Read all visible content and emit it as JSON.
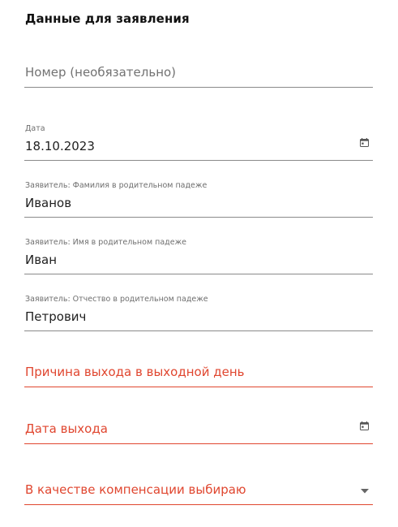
{
  "form": {
    "title": "Данные для заявления",
    "number": {
      "placeholder": "Номер (необязательно)"
    },
    "date": {
      "label": "Дата",
      "value": "18.10.2023"
    },
    "surname": {
      "label": "Заявитель: Фамилия в родительном падеже",
      "value": "Иванов"
    },
    "name": {
      "label": "Заявитель: Имя в родительном падеже",
      "value": "Иван"
    },
    "patronymic": {
      "label": "Заявитель: Отчество в родительном падеже",
      "value": "Петрович"
    },
    "reason": {
      "placeholder": "Причина выхода в выходной день"
    },
    "work_date": {
      "placeholder": "Дата выхода"
    },
    "compensation": {
      "placeholder": "В качестве компенсации выбираю"
    }
  },
  "colors": {
    "error": "#e0462f",
    "underline": "#8a8a8a",
    "text": "#1f1f1f",
    "label": "#6e6e6e"
  },
  "icons": {
    "calendar": "calendar-icon",
    "dropdown": "dropdown-arrow-icon"
  }
}
